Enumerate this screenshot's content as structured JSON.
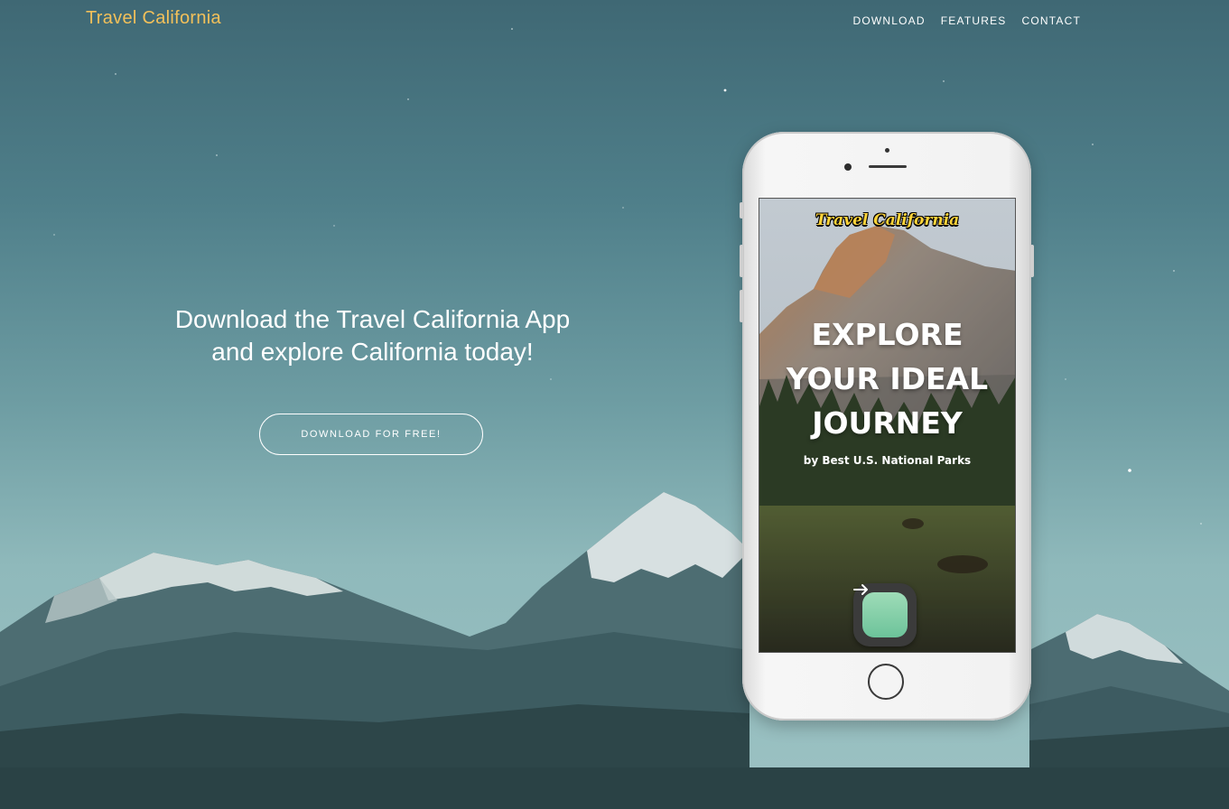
{
  "navbar": {
    "brand": "Travel California",
    "links": [
      "DOWNLOAD",
      "FEATURES",
      "CONTACT"
    ]
  },
  "hero": {
    "headline_line1": "Download the Travel California App",
    "headline_line2": "and explore California today!",
    "cta_label": "DOWNLOAD FOR FREE!"
  },
  "phone_screen": {
    "logo": "Travel California",
    "title_lines": [
      "EXPLORE",
      "YOUR IDEAL",
      "JOURNEY"
    ],
    "subtitle": "by Best U.S. National Parks",
    "next_icon": "arrow-right-icon"
  },
  "colors": {
    "brand": "#f2c05a",
    "sky_top": "#3f6874",
    "sky_bottom": "#9cc2c3",
    "button_green": "#6cc39a",
    "logo_yellow": "#ffd43a"
  }
}
